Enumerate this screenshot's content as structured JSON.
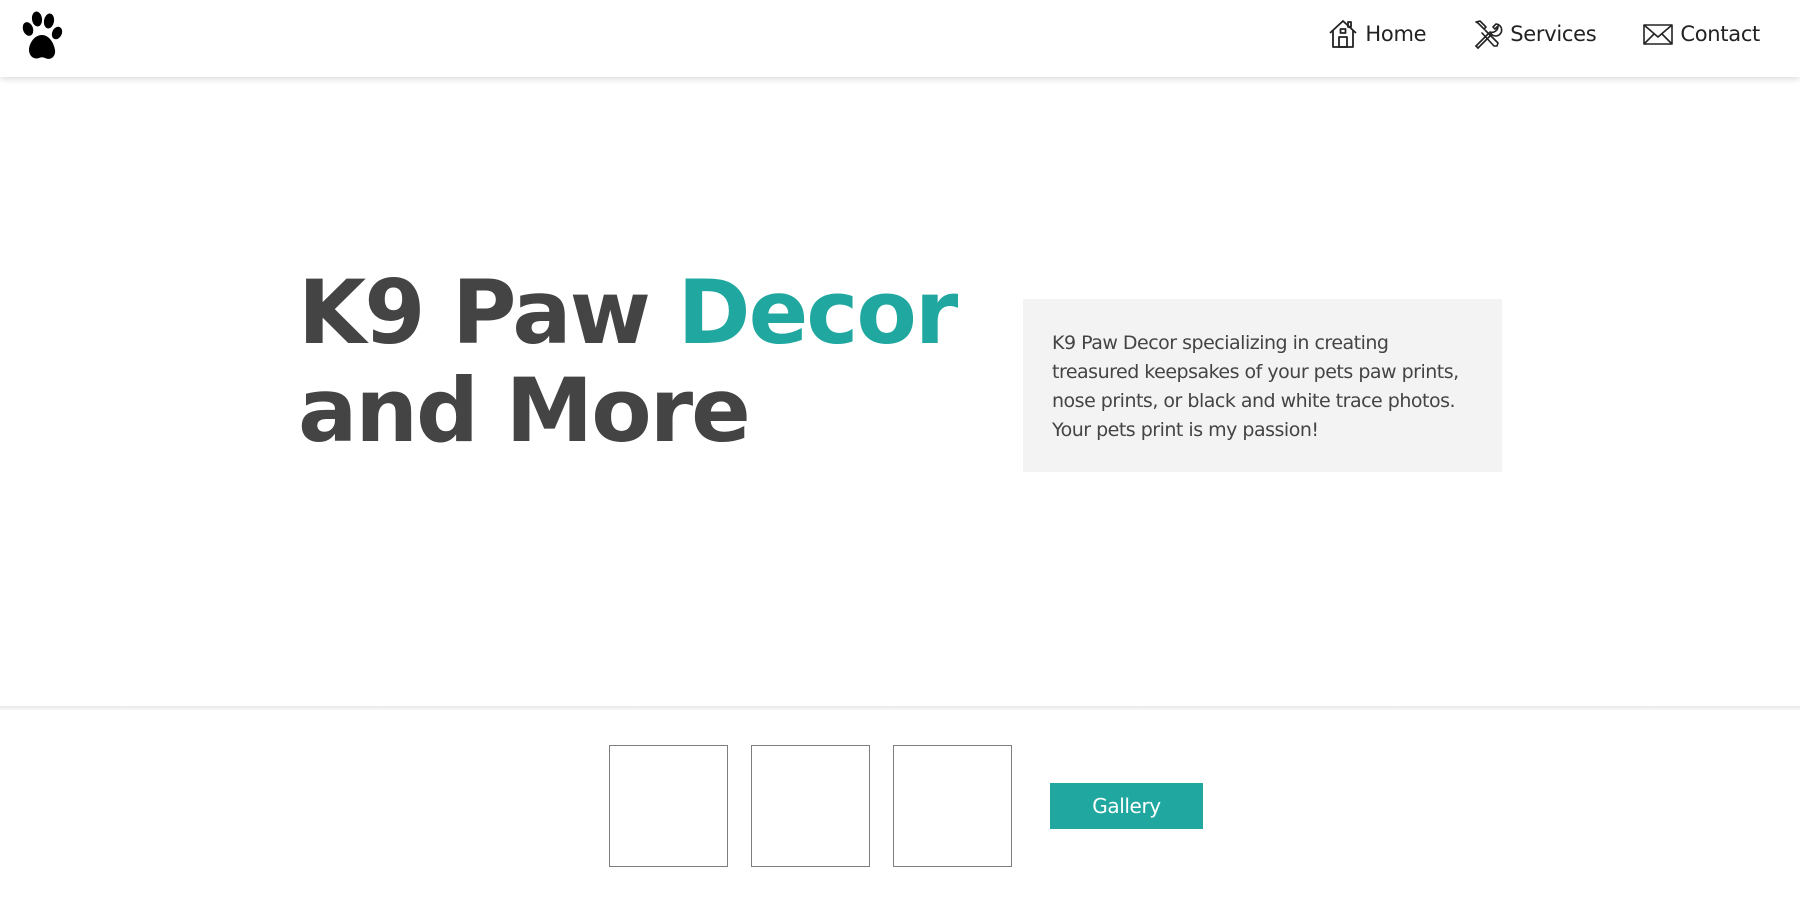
{
  "header": {
    "logo_icon": "paw-print-icon",
    "nav": [
      {
        "icon": "home-icon",
        "label": "Home"
      },
      {
        "icon": "tools-icon",
        "label": "Services"
      },
      {
        "icon": "mail-icon",
        "label": "Contact"
      }
    ]
  },
  "hero": {
    "title_part1": "K9 Paw ",
    "title_accent": "Decor",
    "title_part2": "and More",
    "description": "K9 Paw Decor specializing in creating treasured keepsakes of your pets paw prints, nose prints, or black and white trace photos. Your pets print is my passion!"
  },
  "gallery": {
    "thumbnail_count_label": "",
    "button_label": "Gallery"
  },
  "colors": {
    "accent": "#20a8a0",
    "text": "#444444",
    "box_bg": "#f3f3f3"
  }
}
